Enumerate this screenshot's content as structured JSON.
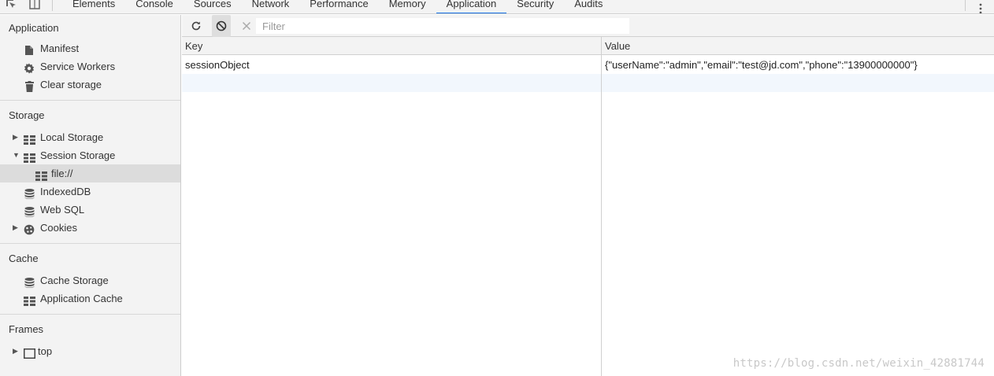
{
  "tabs": [
    {
      "label": "Elements",
      "active": false
    },
    {
      "label": "Console",
      "active": false
    },
    {
      "label": "Sources",
      "active": false
    },
    {
      "label": "Network",
      "active": false
    },
    {
      "label": "Performance",
      "active": false
    },
    {
      "label": "Memory",
      "active": false
    },
    {
      "label": "Application",
      "active": true
    },
    {
      "label": "Security",
      "active": false
    },
    {
      "label": "Audits",
      "active": false
    }
  ],
  "sidebar": {
    "application": {
      "header": "Application",
      "items": [
        {
          "label": "Manifest",
          "icon": "document-icon"
        },
        {
          "label": "Service Workers",
          "icon": "gear-icon"
        },
        {
          "label": "Clear storage",
          "icon": "trash-icon"
        }
      ]
    },
    "storage": {
      "header": "Storage",
      "local_storage": "Local Storage",
      "session_storage": "Session Storage",
      "session_origin": "file://",
      "indexeddb": "IndexedDB",
      "websql": "Web SQL",
      "cookies": "Cookies"
    },
    "cache": {
      "header": "Cache",
      "cache_storage": "Cache Storage",
      "application_cache": "Application Cache"
    },
    "frames": {
      "header": "Frames",
      "top": "top"
    }
  },
  "toolbar": {
    "filter_placeholder": "Filter"
  },
  "table": {
    "columns": [
      "Key",
      "Value"
    ],
    "rows": [
      {
        "key": "sessionObject",
        "value": "{\"userName\":\"admin\",\"email\":\"test@jd.com\",\"phone\":\"13900000000\"}"
      }
    ]
  },
  "colors": {
    "active_tab_underline": "#1a73e8",
    "sidebar_bg": "#f3f3f3",
    "selected_bg": "#dcdcdc",
    "empty_row_bg": "#f2f7fd"
  },
  "watermark": "https://blog.csdn.net/weixin_42881744"
}
